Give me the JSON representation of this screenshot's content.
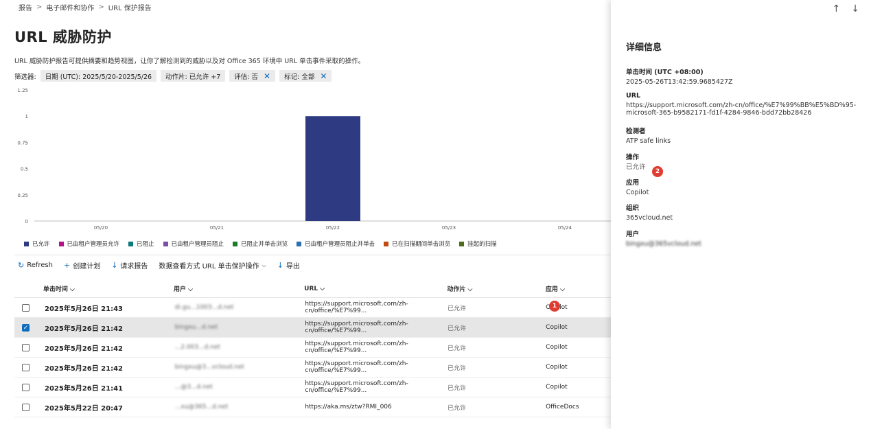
{
  "breadcrumb": {
    "items": [
      "报告",
      "电子邮件和协作",
      "URL 保护报告"
    ],
    "sep": ">"
  },
  "page": {
    "title": "URL 威胁防护",
    "description": "URL 威胁防护报告可提供摘要和趋势视图，让你了解检测到的威胁以及对 Office 365 环境中 URL 单击事件采取的操作。"
  },
  "filters": {
    "label": "筛选器:",
    "chips": [
      "日期 (UTC): 2025/5/20-2025/5/26",
      "动作片: 已允许 +7",
      "评估: 否",
      "标记: 全部"
    ]
  },
  "chart_data": {
    "type": "bar",
    "categories": [
      "05/20",
      "05/21",
      "05/22",
      "05/23",
      "05/24"
    ],
    "series": [
      {
        "name": "已允许",
        "values": [
          0,
          0,
          1,
          0,
          0
        ]
      }
    ],
    "yticks": [
      "0",
      "0.25",
      "0.5",
      "0.75",
      "1",
      "1.25"
    ],
    "ylim": [
      0,
      1.25
    ],
    "bar_color": "#2e3b82"
  },
  "legend": [
    {
      "label": "已允许",
      "color": "#2e3b82"
    },
    {
      "label": "已由租户管理员允许",
      "color": "#b4128a"
    },
    {
      "label": "已阻止",
      "color": "#0a7a7a"
    },
    {
      "label": "已由租户管理员阻止",
      "color": "#7b4fa8"
    },
    {
      "label": "已阻止并单击浏览",
      "color": "#1f7a2a"
    },
    {
      "label": "已由租户管理员阻止并单击",
      "color": "#2c6fb5"
    },
    {
      "label": "已在扫描期间单击浏览",
      "color": "#c04a12"
    },
    {
      "label": "挂起的扫描",
      "color": "#4d6b1a"
    }
  ],
  "toolbar": {
    "refresh": "Refresh",
    "create_plan": "创建计划",
    "request_report": "请求报告",
    "view_data": "数据查看方式 URL 单击保护操作",
    "export": "导出"
  },
  "table": {
    "columns": [
      "单击时间",
      "用户",
      "URL",
      "动作片",
      "应用"
    ],
    "rows": [
      {
        "time": "2025年5月26日 21:43",
        "user": "di.gu...1003...d.net",
        "url": "https://support.microsoft.com/zh-cn/office/%E7%99...",
        "action": "已允许",
        "app": "Copilot",
        "checked": false
      },
      {
        "time": "2025年5月26日 21:42",
        "user": "bingxu...d.net",
        "url": "https://support.microsoft.com/zh-cn/office/%E7%99...",
        "action": "已允许",
        "app": "Copilot",
        "checked": true
      },
      {
        "time": "2025年5月26日 21:42",
        "user": "...2.003...d.net",
        "url": "https://support.microsoft.com/zh-cn/office/%E7%99...",
        "action": "已允许",
        "app": "Copilot",
        "checked": false
      },
      {
        "time": "2025年5月26日 21:42",
        "user": "bingxu@3...vcloud.net",
        "url": "https://support.microsoft.com/zh-cn/office/%E7%99...",
        "action": "已允许",
        "app": "Copilot",
        "checked": false
      },
      {
        "time": "2025年5月26日 21:41",
        "user": "...@3...d.net",
        "url": "https://support.microsoft.com/zh-cn/office/%E7%99...",
        "action": "已允许",
        "app": "Copilot",
        "checked": false
      },
      {
        "time": "2025年5月22日 20:47",
        "user": "...xu@365...d.net",
        "url": "https://aka.ms/ztw?RMI_006",
        "action": "已允许",
        "app": "OfficeDocs",
        "checked": false
      }
    ]
  },
  "details": {
    "title": "详细信息",
    "fields": [
      {
        "label": "单击时间 (UTC +08:00)",
        "value": "2025-05-26T13:42:59.9685427Z"
      },
      {
        "label": "URL",
        "value": "https://support.microsoft.com/zh-cn/office/%E7%99%BB%E5%BD%95-microsoft-365-b9582171-fd1f-4284-9846-bdd72bb28426"
      },
      {
        "label": "检测者",
        "value": "ATP safe links"
      },
      {
        "label": "操作",
        "value": "已允许"
      },
      {
        "label": "应用",
        "value": "Copilot"
      },
      {
        "label": "组织",
        "value": "365vcloud.net"
      },
      {
        "label": "用户",
        "value": "bingxu@365vcloud.net"
      }
    ]
  },
  "annotations": [
    "1",
    "2"
  ]
}
